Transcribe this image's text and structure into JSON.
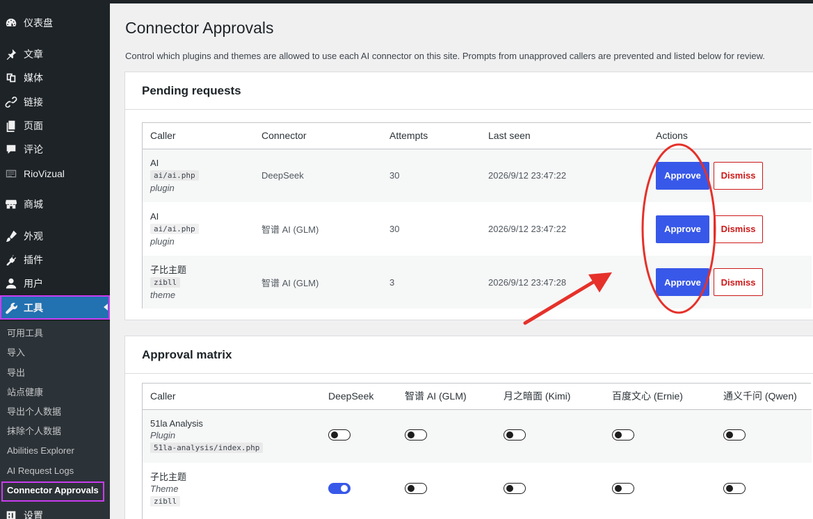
{
  "sidebar": {
    "items": [
      {
        "label": "仪表盘",
        "icon": "dashboard-icon"
      },
      {
        "label": "文章",
        "icon": "pin-icon"
      },
      {
        "label": "媒体",
        "icon": "media-icon"
      },
      {
        "label": "链接",
        "icon": "link-icon"
      },
      {
        "label": "页面",
        "icon": "page-icon"
      },
      {
        "label": "评论",
        "icon": "comment-icon"
      },
      {
        "label": "RioVizual",
        "icon": "riovizual-icon"
      },
      {
        "label": "商城",
        "icon": "store-icon"
      },
      {
        "label": "外观",
        "icon": "appearance-icon"
      },
      {
        "label": "插件",
        "icon": "plugin-icon"
      },
      {
        "label": "用户",
        "icon": "user-icon"
      },
      {
        "label": "工具",
        "icon": "wrench-icon"
      },
      {
        "label": "设置",
        "icon": "settings-icon"
      }
    ],
    "submenu": [
      "可用工具",
      "导入",
      "导出",
      "站点健康",
      "导出个人数据",
      "抹除个人数据",
      "Abilities Explorer",
      "AI Request Logs",
      "Connector Approvals"
    ]
  },
  "page": {
    "title": "Connector Approvals",
    "description": "Control which plugins and themes are allowed to use each AI connector on this site. Prompts from unapproved callers are prevented and listed below for review."
  },
  "pending": {
    "title": "Pending requests",
    "columns": [
      "Caller",
      "Connector",
      "Attempts",
      "Last seen",
      "Actions"
    ],
    "approve_label": "Approve",
    "dismiss_label": "Dismiss",
    "rows": [
      {
        "name": "AI",
        "slug": "ai/ai.php",
        "type": "plugin",
        "connector": "DeepSeek",
        "attempts": "30",
        "last_seen": "2026/9/12 23:47:22"
      },
      {
        "name": "AI",
        "slug": "ai/ai.php",
        "type": "plugin",
        "connector": "智谱 AI (GLM)",
        "attempts": "30",
        "last_seen": "2026/9/12 23:47:22"
      },
      {
        "name": "子比主题",
        "slug": "zibll",
        "type": "theme",
        "connector": "智谱 AI (GLM)",
        "attempts": "3",
        "last_seen": "2026/9/12 23:47:28"
      }
    ]
  },
  "matrix": {
    "title": "Approval matrix",
    "columns": [
      "Caller",
      "DeepSeek",
      "智谱 AI (GLM)",
      "月之暗面 (Kimi)",
      "百度文心 (Ernie)",
      "通义千问 (Qwen)"
    ],
    "rows": [
      {
        "name": "51la Analysis",
        "type": "Plugin",
        "slug": "51la-analysis/index.php",
        "toggles": [
          false,
          false,
          false,
          false,
          false
        ]
      },
      {
        "name": "子比主题",
        "type": "Theme",
        "slug": "zibll",
        "toggles": [
          true,
          false,
          false,
          false,
          false
        ]
      }
    ]
  },
  "colors": {
    "accent": "#3858e9",
    "danger": "#cc1818",
    "annotation": "#e5312a",
    "highlight": "#c93cf0"
  }
}
